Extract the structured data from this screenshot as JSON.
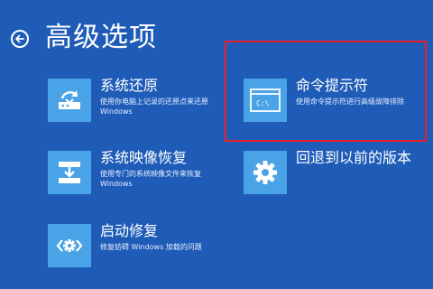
{
  "header": {
    "back_icon": "back-arrow-circle-icon",
    "title": "高级选项"
  },
  "colors": {
    "background": "#1f5cb8",
    "tile": "#4aa3e6",
    "highlight_frame": "#e8212a"
  },
  "options": [
    {
      "id": "system-restore",
      "icon": "system-restore-icon",
      "title": "系统还原",
      "desc_line1": "使用你电脑上记录的还原点来还原",
      "desc_line2": "Windows"
    },
    {
      "id": "command-prompt",
      "icon": "command-prompt-icon",
      "title": "命令提示符",
      "desc_line1": "使用命令提示符进行高级故障排除",
      "highlighted": true
    },
    {
      "id": "system-image-recovery",
      "icon": "system-image-recovery-icon",
      "title": "系统映像恢复",
      "desc_line1": "使用专门的系统映像文件来恢复",
      "desc_line2": "Windows"
    },
    {
      "id": "go-back",
      "icon": "gear-icon",
      "title": "回退到以前的版本"
    },
    {
      "id": "startup-repair",
      "icon": "startup-repair-icon",
      "title": "启动修复",
      "desc_line1": "修复妨碍 Windows 加载的问题"
    }
  ]
}
